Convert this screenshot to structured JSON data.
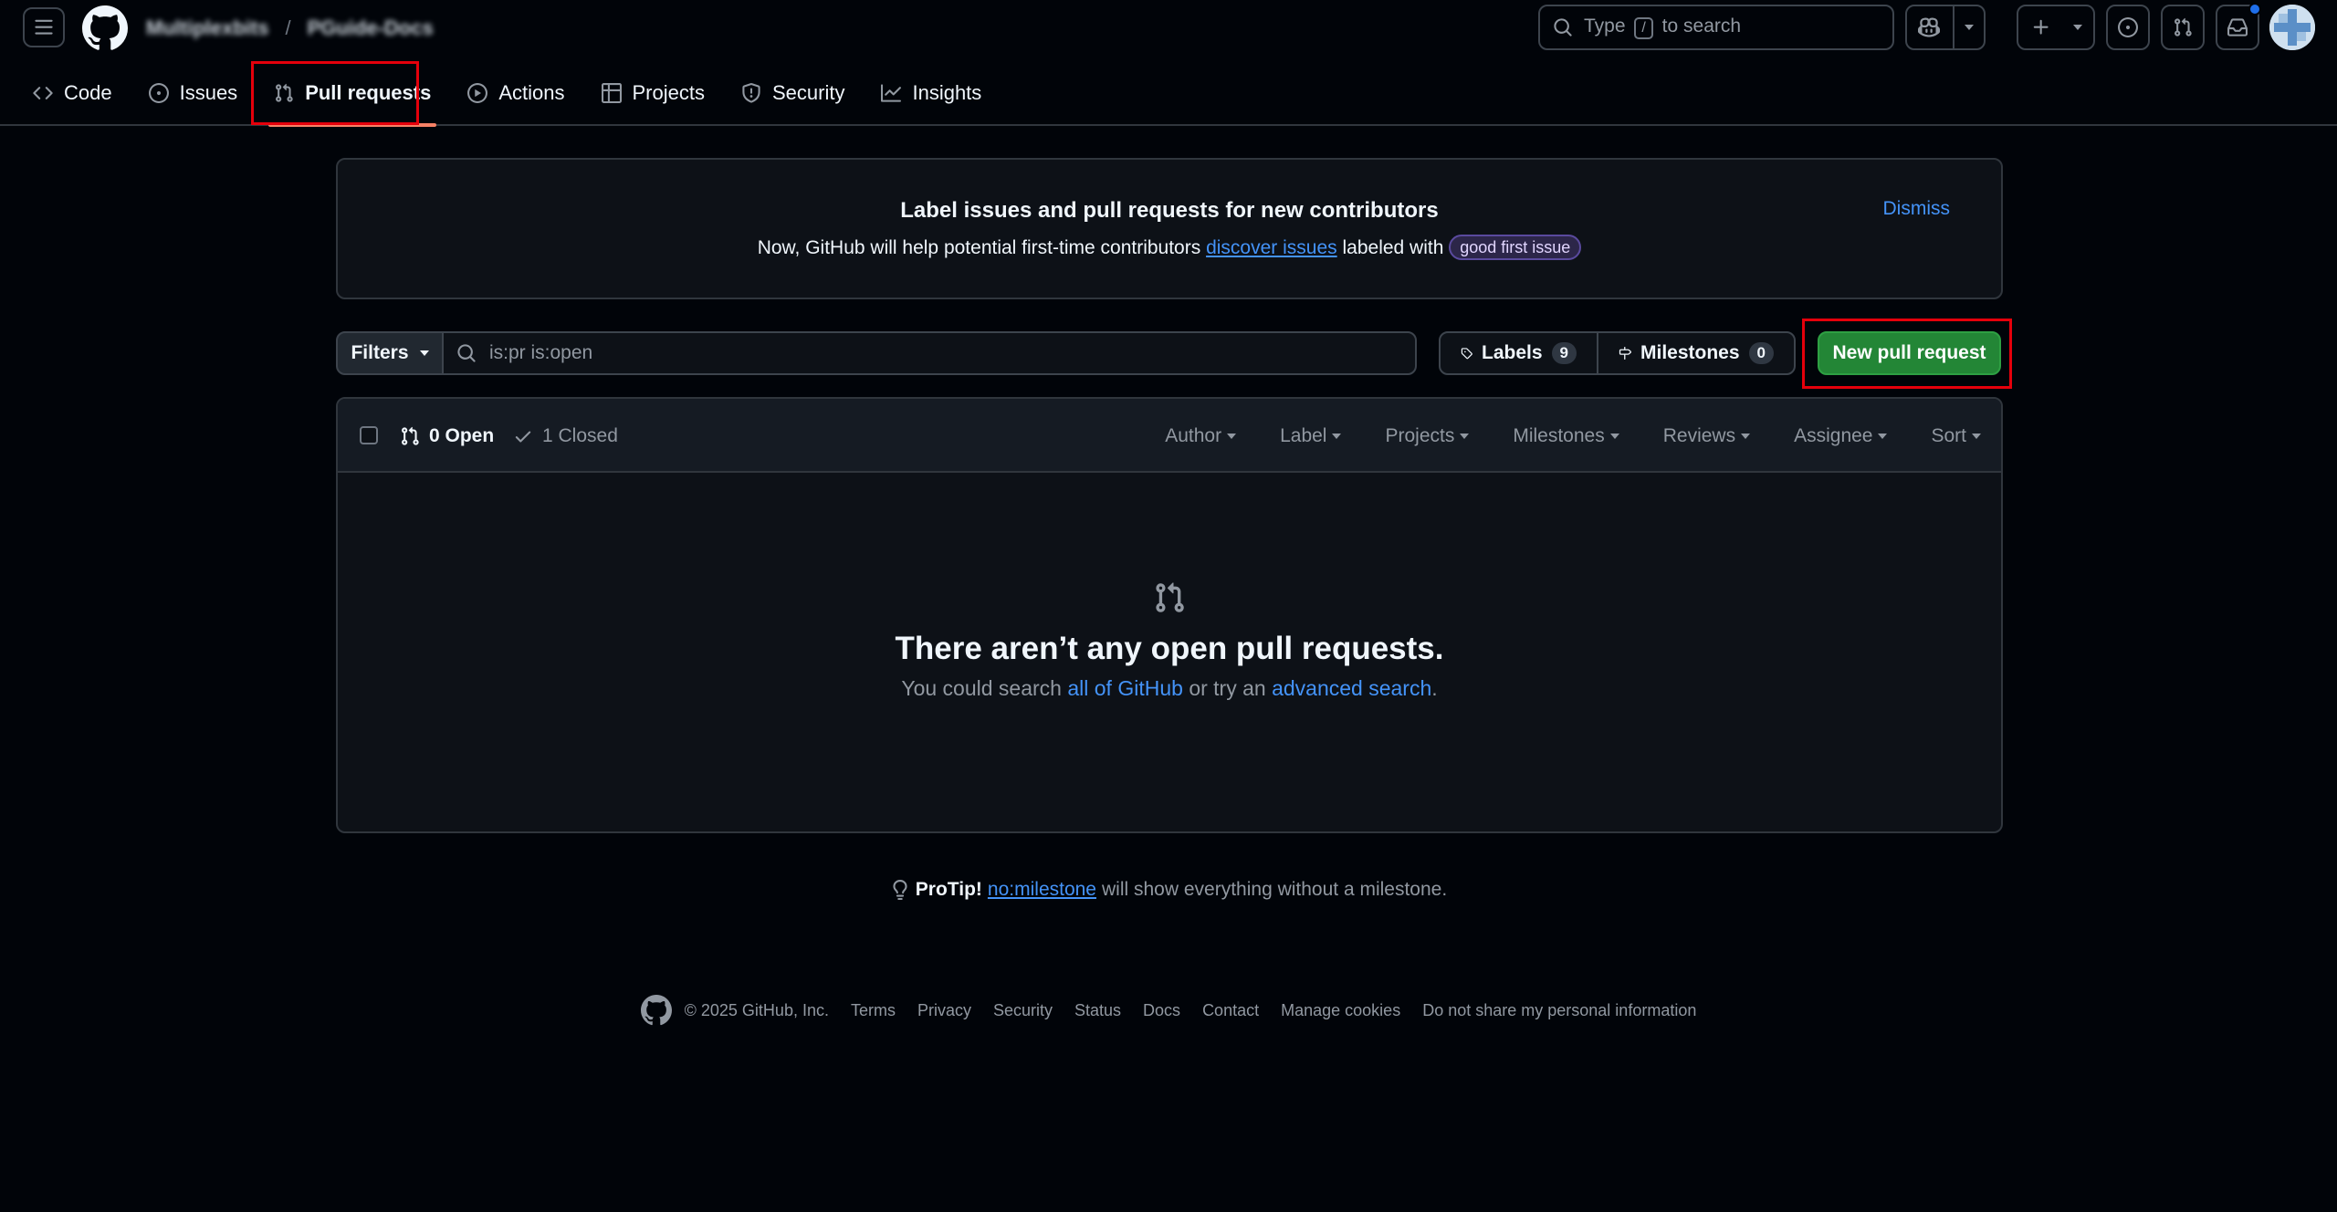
{
  "header": {
    "owner": "Multiplexbits",
    "repo": "PGuide-Docs",
    "search_prefix": "Type",
    "search_key": "/",
    "search_suffix": "to search"
  },
  "repo_nav": {
    "items": [
      {
        "label": "Code",
        "icon": "code-icon"
      },
      {
        "label": "Issues",
        "icon": "issue-opened-icon"
      },
      {
        "label": "Pull requests",
        "icon": "git-pull-request-icon",
        "active": true
      },
      {
        "label": "Actions",
        "icon": "play-icon"
      },
      {
        "label": "Projects",
        "icon": "table-icon"
      },
      {
        "label": "Security",
        "icon": "shield-icon"
      },
      {
        "label": "Insights",
        "icon": "graph-icon"
      }
    ]
  },
  "banner": {
    "title": "Label issues and pull requests for new contributors",
    "text_before": "Now, GitHub will help potential first-time contributors",
    "link": "discover issues",
    "text_after": "labeled with",
    "label": "good first issue",
    "dismiss": "Dismiss"
  },
  "filter_bar": {
    "filters_label": "Filters",
    "query": "is:pr is:open",
    "labels_label": "Labels",
    "labels_count": "9",
    "milestones_label": "Milestones",
    "milestones_count": "0",
    "new_button": "New pull request"
  },
  "list": {
    "open_label": "0 Open",
    "closed_label": "1 Closed",
    "menus": [
      "Author",
      "Label",
      "Projects",
      "Milestones",
      "Reviews",
      "Assignee",
      "Sort"
    ],
    "blank_title": "There aren’t any open pull requests.",
    "blank_before": "You could search",
    "blank_link1": "all of GitHub",
    "blank_mid": "or try an",
    "blank_link2": "advanced search",
    "blank_after": "."
  },
  "protip": {
    "lead": "ProTip!",
    "link": "no:milestone",
    "text": "will show everything without a milestone."
  },
  "footer": {
    "copyright": "© 2025 GitHub, Inc.",
    "links": [
      "Terms",
      "Privacy",
      "Security",
      "Status",
      "Docs",
      "Contact",
      "Manage cookies",
      "Do not share my personal information"
    ]
  },
  "colors": {
    "background": "#010409",
    "canvas": "#0d1117",
    "border": "#30363d",
    "accent_link": "#4493f8",
    "primary_button": "#238636",
    "active_tab_underline": "#f78166",
    "annotation_box": "#e5000b"
  }
}
